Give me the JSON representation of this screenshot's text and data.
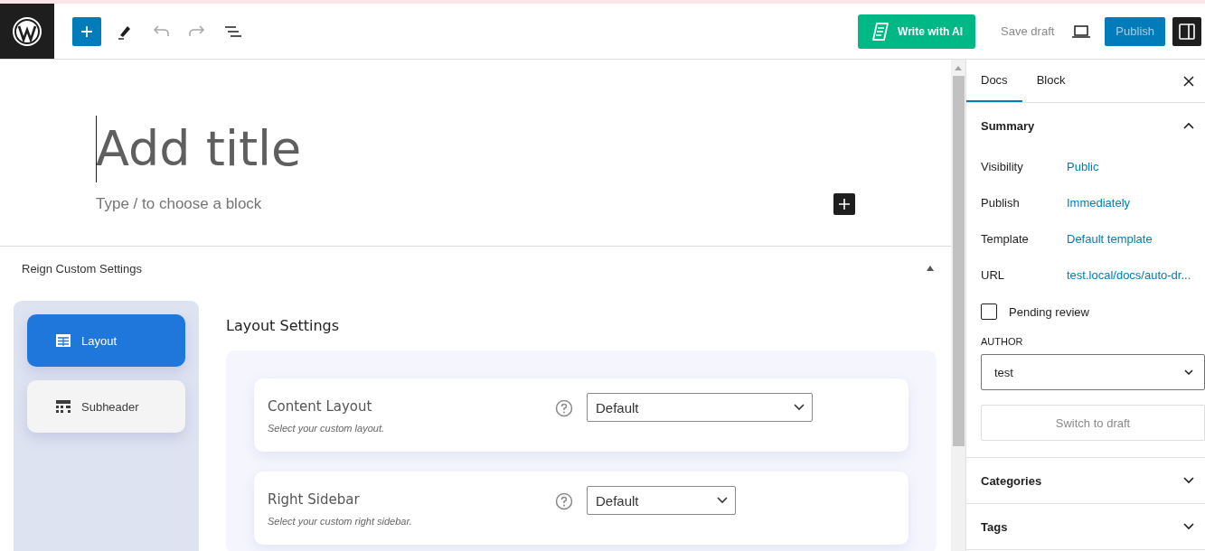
{
  "toolbar": {
    "tools": [
      {
        "kind": "add",
        "disabled": false
      },
      {
        "kind": "pen",
        "disabled": false
      },
      {
        "kind": "undo",
        "disabled": true
      },
      {
        "kind": "redo",
        "disabled": true
      },
      {
        "kind": "outline",
        "disabled": false
      }
    ],
    "ai_button": "Write with AI",
    "save_draft": "Save draft",
    "publish": "Publish"
  },
  "editor": {
    "title_placeholder": "Add title",
    "block_placeholder": "Type / to choose a block"
  },
  "meta_box": {
    "title": "Reign Custom Settings",
    "expanded": true,
    "nav": [
      {
        "label": "Layout",
        "kind": "table",
        "selected": true
      },
      {
        "label": "Subheader",
        "kind": "grid",
        "selected": false
      }
    ],
    "section_title": "Layout Settings",
    "settings": [
      {
        "label": "Content Layout",
        "hint": "Select your custom layout.",
        "value": "Default",
        "wide": true
      },
      {
        "label": "Right Sidebar",
        "hint": "Select your custom right sidebar.",
        "value": "Default",
        "wide": false
      }
    ]
  },
  "sidebar": {
    "tabs": [
      {
        "label": "Docs",
        "selected": true
      },
      {
        "label": "Block",
        "selected": false
      }
    ],
    "summary": {
      "title": "Summary",
      "expanded": true,
      "rows": [
        {
          "label": "Visibility",
          "value": "Public"
        },
        {
          "label": "Publish",
          "value": "Immediately"
        },
        {
          "label": "Template",
          "value": "Default template"
        },
        {
          "label": "URL",
          "value": "test.local/docs/auto-dr..."
        }
      ],
      "pending_review": {
        "label": "Pending review",
        "checked": false
      },
      "author_label": "AUTHOR",
      "author": "test",
      "switch_button": "Switch to draft"
    },
    "panels": [
      {
        "title": "Categories",
        "expanded": false
      },
      {
        "title": "Tags",
        "expanded": false
      }
    ]
  }
}
